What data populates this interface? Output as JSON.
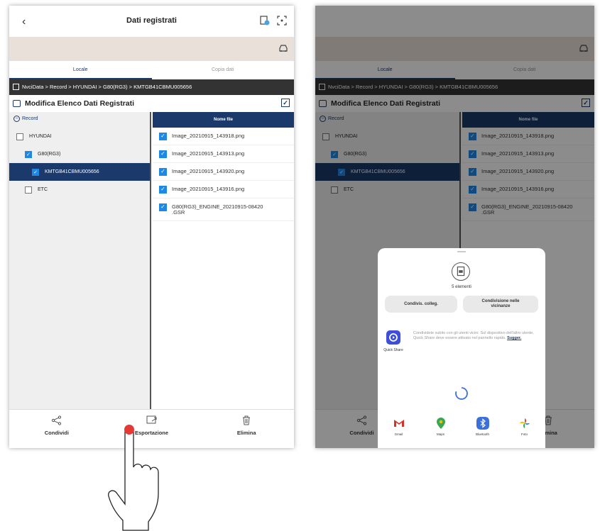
{
  "screen1": {
    "header": {
      "title": "Dati registrati"
    },
    "tabs": [
      {
        "label": "Locale",
        "active": true
      },
      {
        "label": "Copia dati",
        "active": false
      }
    ],
    "path": "NvciData > Record > HYUNDAI > G80(RG3) > KMTGB41CBMU005656",
    "edit_title": "Modifica Elenco Dati Registrati",
    "tree": {
      "root": "Record",
      "items": [
        {
          "label": "HYUNDAI",
          "checked": false
        },
        {
          "label": "G80(RG3)",
          "checked": true
        },
        {
          "label": "KMTGB41CBMU005656",
          "checked": true,
          "selected": true
        },
        {
          "label": "ETC",
          "checked": false
        }
      ]
    },
    "files": {
      "header": "Nome file",
      "items": [
        "Image_20210915_143918.png",
        "Image_20210915_143913.png",
        "Image_20210915_143920.png",
        "Image_20210915_143916.png",
        "G80(RG3)_ENGINE_20210915-08420\n.GSR"
      ]
    },
    "bottom": {
      "share": "Condividi",
      "export": "Esportazione",
      "delete": "Elimina"
    }
  },
  "screen2": {
    "tabs": [
      {
        "label": "Locale"
      },
      {
        "label": "Copia dati"
      }
    ],
    "path": "NvciData > Record > HYUNDAI > G80(RG3) > KMTGB41CBMU005656",
    "edit_title": "Modifica Elenco Dati Registrati",
    "tree": {
      "root": "Record",
      "items": [
        {
          "label": "HYUNDAI"
        },
        {
          "label": "G80(RG3)"
        },
        {
          "label": "KMTGB41CBMU005656"
        },
        {
          "label": "ETC"
        }
      ]
    },
    "files": {
      "header": "Nome file",
      "items": [
        "Image_20210915_143918.png",
        "Image_20210915_143913.png",
        "Image_20210915_143920.png",
        "Image_20210915_143916.png",
        "G80(RG3)_ENGINE_20210915-08420\n.GSR"
      ]
    },
    "bottom": {
      "share": "Condividi",
      "delete": "Elimina"
    },
    "share_sheet": {
      "count": "5 elementi",
      "copy_link": "Condivis. colleg.",
      "nearby": "Condivisione nelle\nvicinanze",
      "quick_share_label": "Quick Share",
      "quick_share_text": "Condividete subito con gli utenti vicini. Sul dispositivo dell'altro utente, Quick Share deve essere attivato nel pannello rapido.",
      "quick_share_link": "Sugger.",
      "apps": [
        "Gmail",
        "Maps",
        "Bluetooth",
        "Foto"
      ]
    }
  },
  "colors": {
    "navy": "#1b3a6b",
    "check_blue": "#1e88e5",
    "vehicle_band": "#e9e1d9",
    "path_bar": "#333333",
    "touch_red": "#e53935"
  }
}
